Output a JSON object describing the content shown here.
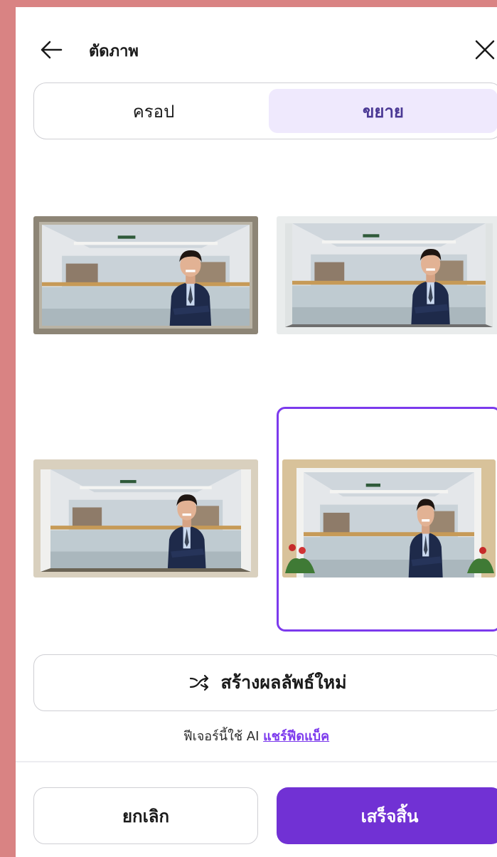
{
  "header": {
    "title": "ตัดภาพ",
    "back_icon": "arrow-left-icon",
    "close_icon": "close-icon"
  },
  "segmented": {
    "options": [
      "ครอป",
      "ขยาย"
    ],
    "selected": "ขยาย"
  },
  "results": {
    "items": [
      {
        "variant": "stone window frame"
      },
      {
        "variant": "white wooden frame"
      },
      {
        "variant": "beige window frame"
      },
      {
        "variant": "pergola with flowers"
      }
    ],
    "selected_index": 3
  },
  "regenerate": {
    "icon": "shuffle-icon",
    "label": "สร้างผลลัพธ์ใหม่"
  },
  "ai_note": {
    "text": "ฟีเจอร์นี้ใช้ AI",
    "link_label": "แชร์ฟีดแบ็ค"
  },
  "footer": {
    "cancel_label": "ยกเลิก",
    "done_label": "เสร็จสิ้น"
  },
  "colors": {
    "accent": "#7131d4",
    "selected_border": "#7c3aed",
    "segment_selected_bg": "#efe9fd",
    "page_background": "#d98383"
  }
}
